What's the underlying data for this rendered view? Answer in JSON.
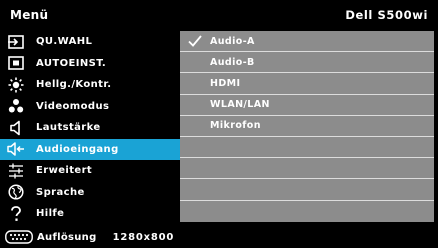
{
  "header": {
    "title": "Menü",
    "model": "Dell S500wi"
  },
  "menu": {
    "items": [
      {
        "label": "QU.WAHL",
        "icon": "input-source-icon"
      },
      {
        "label": "AUTOEINST.",
        "icon": "auto-adjust-icon"
      },
      {
        "label": "Hellg./Kontr.",
        "icon": "brightness-icon"
      },
      {
        "label": "Videomodus",
        "icon": "video-mode-icon"
      },
      {
        "label": "Lautstärke",
        "icon": "speaker-icon"
      },
      {
        "label": "Audioeingang",
        "icon": "audio-input-icon"
      },
      {
        "label": "Erweitert",
        "icon": "sliders-icon"
      },
      {
        "label": "Sprache",
        "icon": "globe-icon"
      },
      {
        "label": "Hilfe",
        "icon": "question-icon"
      }
    ],
    "selected_index": 5
  },
  "submenu": {
    "options": [
      "Audio-A",
      "Audio-B",
      "HDMI",
      "WLAN/LAN",
      "Mikrofon"
    ],
    "checked_index": 0,
    "total_rows": 9
  },
  "status": {
    "icon": "resolution-icon",
    "label": "Auflösung",
    "value": "1280x800"
  },
  "colors": {
    "background": "#000000",
    "selected": "#1aa3d5",
    "panel": "#8c8c8c",
    "divider": "#dcdcdc",
    "text": "#ffffff"
  }
}
